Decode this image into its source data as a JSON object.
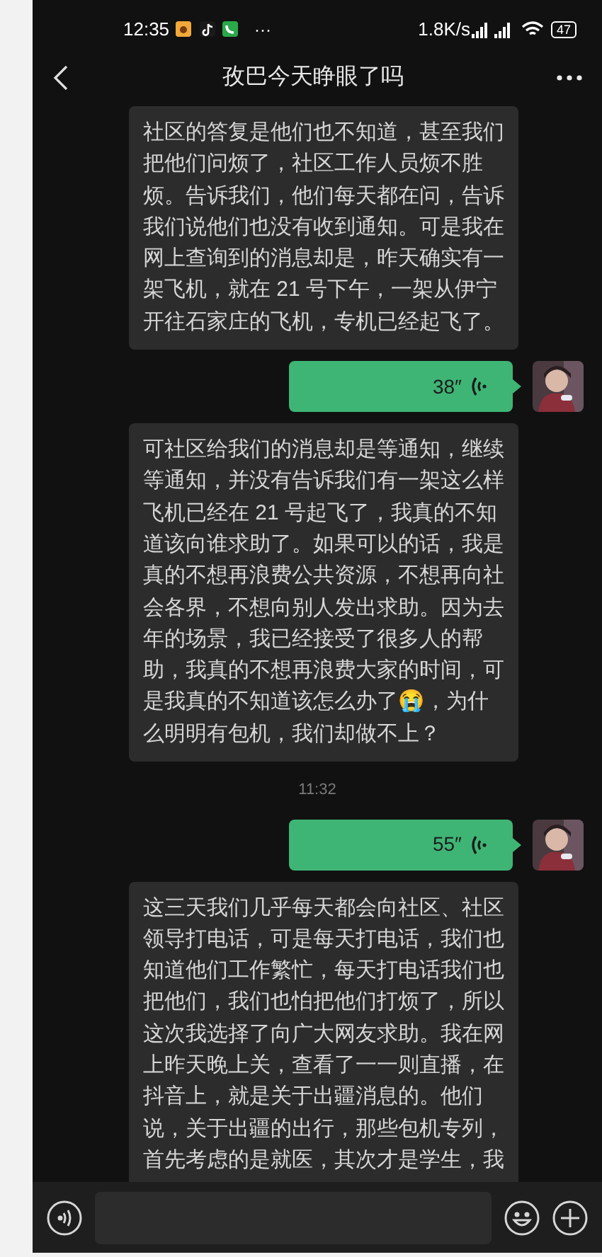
{
  "status_bar": {
    "time": "12:35",
    "more": "···",
    "speed": "1.8K/s",
    "battery": "47"
  },
  "header": {
    "title": "孜巴今天睁眼了吗"
  },
  "messages": [
    {
      "kind": "text",
      "text": "社区的答复是他们也不知道，甚至我们把他们问烦了，社区工作人员烦不胜烦。告诉我们，他们每天都在问，告诉我们说他们也没有收到通知。可是我在网上查询到的消息却是，昨天确实有一架飞机，就在 21 号下午，一架从伊宁开往石家庄的飞机，专机已经起飞了。"
    },
    {
      "kind": "voice",
      "duration": "38″"
    },
    {
      "kind": "text",
      "text": "可社区给我们的消息却是等通知，继续等通知，并没有告诉我们有一架这么样飞机已经在 21 号起飞了，我真的不知道该向谁求助了。如果可以的话，我是真的不想再浪费公共资源，不想再向社会各界，不想向别人发出求助。因为去年的场景，我已经接受了很多人的帮助，我真的不想再浪费大家的时间，可是我真的不知道该怎么办了😭，为什么明明有包机，我们却做不上？"
    },
    {
      "kind": "time",
      "text": "11:32"
    },
    {
      "kind": "voice",
      "duration": "55″"
    },
    {
      "kind": "text",
      "text": "这三天我们几乎每天都会向社区、社区领导打电话，可是每天打电话，我们也知道他们工作繁忙，每天打电话我们也把他们，我们也怕把他们打烦了，所以这次我选择了向广大网友求助。我在网上昨天晚上关，查看了一一则直播，在抖音上，就是关于出疆消息的。他们说，关于出疆的出行，那些包机专列，首先考虑的是就医，其次才是学生，我"
    }
  ]
}
